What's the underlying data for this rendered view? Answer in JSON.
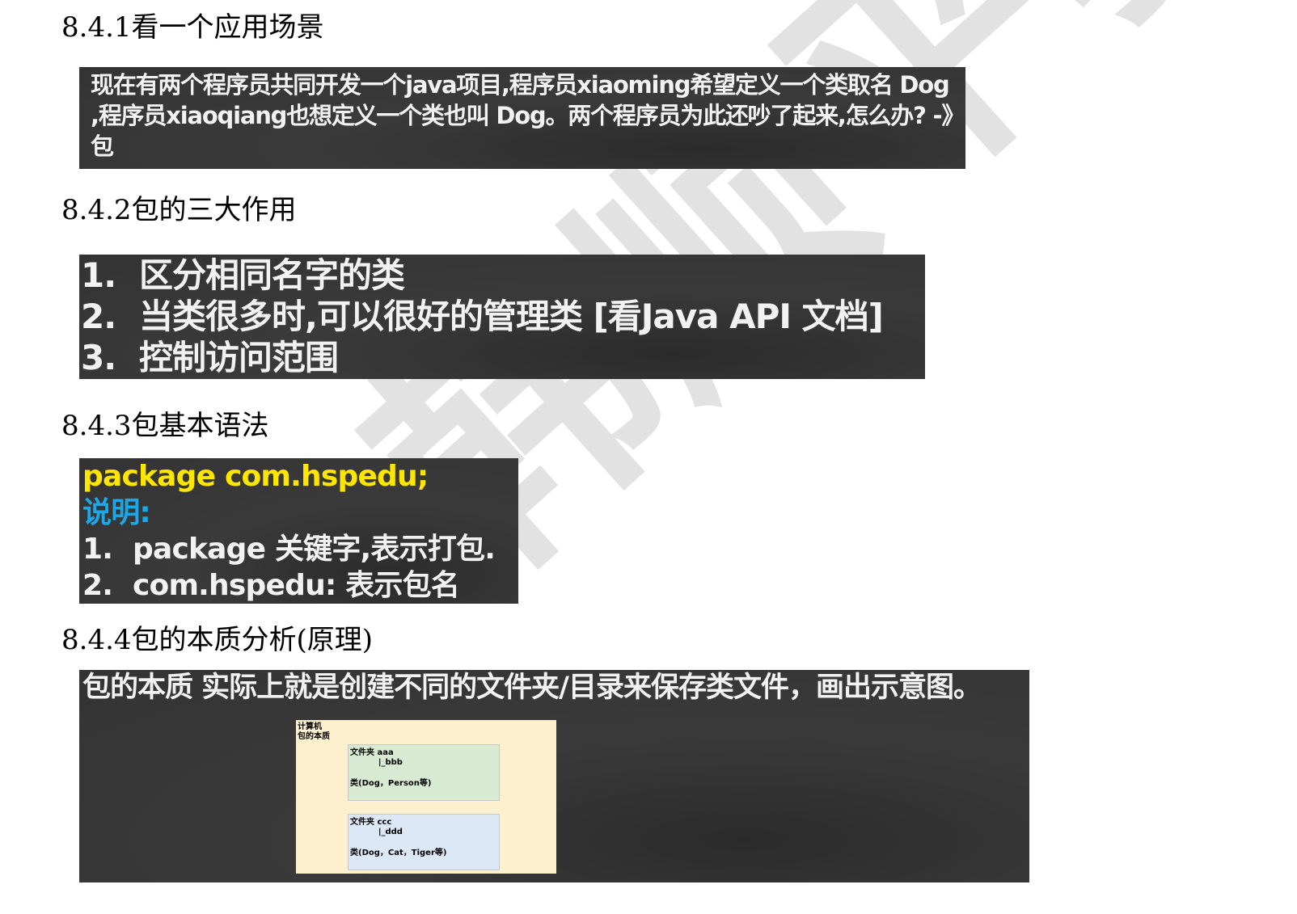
{
  "watermark": "韩顺平教育",
  "sections": {
    "s1": {
      "heading": "8.4.1看一个应用场景",
      "text": "现在有两个程序员共同开发一个java项目,程序员xiaoming希望定义一个类取名 Dog ,程序员xiaoqiang也想定义一个类也叫 Dog。两个程序员为此还吵了起来,怎么办? -》包"
    },
    "s2": {
      "heading": "8.4.2包的三大作用",
      "items": [
        {
          "num": "1.",
          "text": "区分相同名字的类"
        },
        {
          "num": "2.",
          "text": "当类很多时,可以很好的管理类 [看Java API 文档]"
        },
        {
          "num": "3.",
          "text": "控制访问范围"
        }
      ]
    },
    "s3": {
      "heading": "8.4.3包基本语法",
      "code": "package com.hspedu;",
      "label": "说明:",
      "items": [
        {
          "num": "1.",
          "text": "package 关键字,表示打包."
        },
        {
          "num": "2.",
          "text": "com.hspedu: 表示包名"
        }
      ]
    },
    "s4": {
      "heading": "8.4.4包的本质分析(原理)",
      "title": "包的本质 实际上就是创建不同的文件夹/目录来保存类文件，画出示意图。",
      "diagram": {
        "label1": "计算机",
        "label2": "包的本质",
        "box1": {
          "line1": "文件夹 aaa",
          "line2": "          |_bbb",
          "line3": "类(Dog，Person等)"
        },
        "box2": {
          "line1": "文件夹 ccc",
          "line2": "          |_ddd",
          "line3": "类(Dog，Cat，Tiger等)"
        }
      }
    }
  }
}
